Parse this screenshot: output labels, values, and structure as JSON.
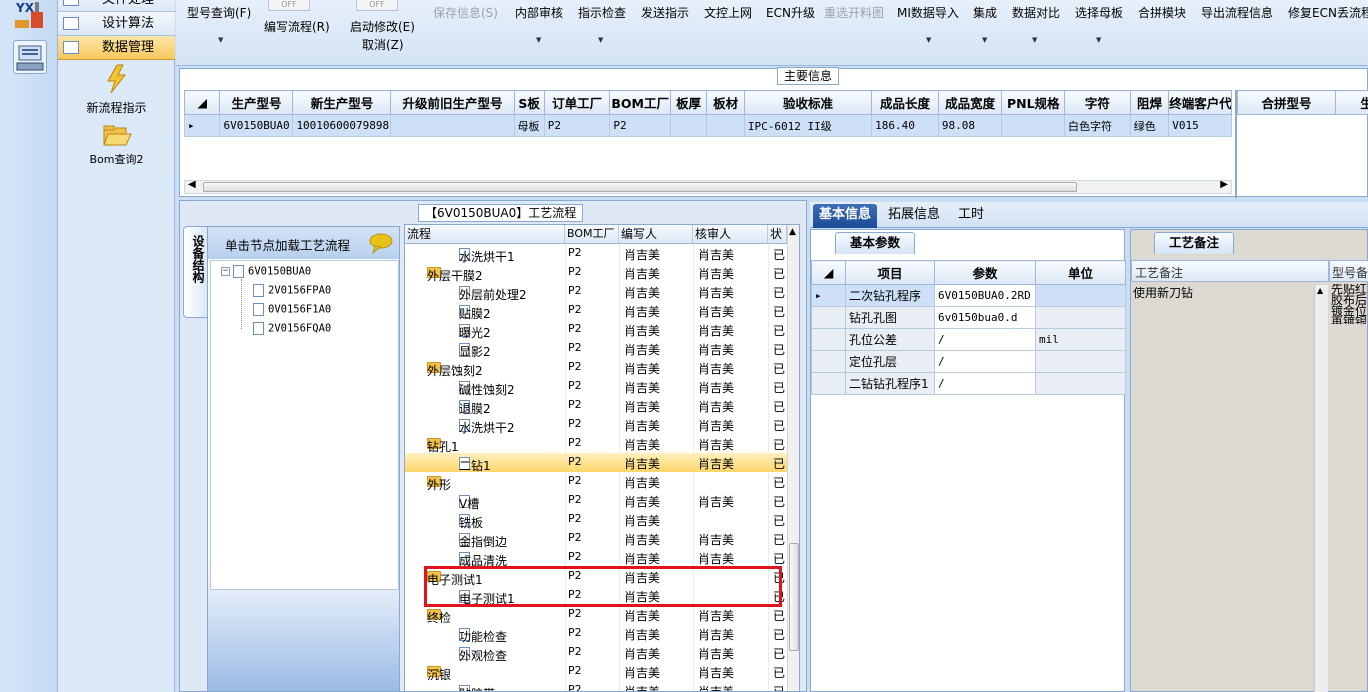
{
  "app": {
    "logo_text": "YX"
  },
  "nav": {
    "items": [
      {
        "label": "文件处理"
      },
      {
        "label": "设计算法"
      },
      {
        "label": "数据管理"
      }
    ],
    "buttons": [
      {
        "label": "新流程指示"
      },
      {
        "label": "Bom查询2"
      }
    ]
  },
  "toolbar": {
    "off_label": "OFF",
    "items": [
      {
        "label": "型号查询(F)"
      },
      {
        "label": "编写流程(R)"
      },
      {
        "label": "启动修改(E)"
      },
      {
        "label": "取消(Z)"
      },
      {
        "label": "保存信息(S)"
      },
      {
        "label": "内部审核"
      },
      {
        "label": "指示检查"
      },
      {
        "label": "发送指示"
      },
      {
        "label": "文控上网"
      },
      {
        "label": "ECN升级"
      },
      {
        "label": "重选开料图"
      },
      {
        "label": "MI数据导入"
      },
      {
        "label": "集成"
      },
      {
        "label": "数据对比"
      },
      {
        "label": "选择母板"
      },
      {
        "label": "合拼模块"
      },
      {
        "label": "导出流程信息"
      },
      {
        "label": "修复ECN丢流程"
      }
    ]
  },
  "main_info": {
    "title": "主要信息",
    "columns": [
      "生产型号",
      "新生产型号",
      "升级前旧生产型号",
      "S板",
      "订单工厂",
      "BOM工厂",
      "板厚",
      "板材",
      "验收标准",
      "成品长度",
      "成品宽度",
      "PNL规格",
      "字符",
      "阻焊",
      "终端客户代码"
    ],
    "row": [
      "6V0150BUA0",
      "10010600079898",
      "",
      "母板",
      "P2",
      "P2",
      "",
      "",
      "IPC-6012 II级",
      "186.40",
      "98.08",
      "",
      "白色字符",
      "绿色",
      "V015"
    ],
    "side_columns": [
      "合拼型号",
      "生"
    ]
  },
  "process": {
    "title": "【6V0150BUA0】工艺流程",
    "side_tab": "设备结构",
    "tree_header": "单击节点加载工艺流程",
    "tree": [
      {
        "label": "6V0150BUA0",
        "level": 0
      },
      {
        "label": "2V0156FPA0",
        "level": 1
      },
      {
        "label": "0V0156F1A0",
        "level": 1
      },
      {
        "label": "2V0156FQA0",
        "level": 1
      }
    ],
    "grid_columns": [
      "流程",
      "BOM工厂",
      "编写人",
      "核审人",
      "状"
    ],
    "rows": [
      {
        "name": "水洗烘干1",
        "folder": false,
        "factory": "P2",
        "writer": "肖吉美",
        "reviewer": "肖吉美",
        "status": "已"
      },
      {
        "name": "外层干膜2",
        "folder": true,
        "factory": "P2",
        "writer": "肖吉美",
        "reviewer": "肖吉美",
        "status": "已"
      },
      {
        "name": "外层前处理2",
        "folder": false,
        "factory": "P2",
        "writer": "肖吉美",
        "reviewer": "肖吉美",
        "status": "已"
      },
      {
        "name": "贴膜2",
        "folder": false,
        "factory": "P2",
        "writer": "肖吉美",
        "reviewer": "肖吉美",
        "status": "已"
      },
      {
        "name": "曝光2",
        "folder": false,
        "factory": "P2",
        "writer": "肖吉美",
        "reviewer": "肖吉美",
        "status": "已"
      },
      {
        "name": "显影2",
        "folder": false,
        "factory": "P2",
        "writer": "肖吉美",
        "reviewer": "肖吉美",
        "status": "已"
      },
      {
        "name": "外层蚀刻2",
        "folder": true,
        "factory": "P2",
        "writer": "肖吉美",
        "reviewer": "肖吉美",
        "status": "已"
      },
      {
        "name": "碱性蚀刻2",
        "folder": false,
        "factory": "P2",
        "writer": "肖吉美",
        "reviewer": "肖吉美",
        "status": "已"
      },
      {
        "name": "退膜2",
        "folder": false,
        "factory": "P2",
        "writer": "肖吉美",
        "reviewer": "肖吉美",
        "status": "已"
      },
      {
        "name": "水洗烘干2",
        "folder": false,
        "factory": "P2",
        "writer": "肖吉美",
        "reviewer": "肖吉美",
        "status": "已"
      },
      {
        "name": "钻孔1",
        "folder": true,
        "factory": "P2",
        "writer": "肖吉美",
        "reviewer": "肖吉美",
        "status": "已"
      },
      {
        "name": "二钻1",
        "folder": false,
        "factory": "P2",
        "writer": "肖吉美",
        "reviewer": "肖吉美",
        "status": "已",
        "selected": true
      },
      {
        "name": "外形",
        "folder": true,
        "factory": "P2",
        "writer": "肖吉美",
        "reviewer": "",
        "status": "已"
      },
      {
        "name": "V槽",
        "folder": false,
        "factory": "P2",
        "writer": "肖吉美",
        "reviewer": "肖吉美",
        "status": "已"
      },
      {
        "name": "铣板",
        "folder": false,
        "factory": "P2",
        "writer": "肖吉美",
        "reviewer": "",
        "status": "已"
      },
      {
        "name": "金指倒边",
        "folder": false,
        "factory": "P2",
        "writer": "肖吉美",
        "reviewer": "肖吉美",
        "status": "已"
      },
      {
        "name": "成品清洗",
        "folder": false,
        "factory": "P2",
        "writer": "肖吉美",
        "reviewer": "肖吉美",
        "status": "已"
      },
      {
        "name": "电子测试1",
        "folder": true,
        "factory": "P2",
        "writer": "肖吉美",
        "reviewer": "",
        "status": "已"
      },
      {
        "name": "电子测试1",
        "folder": false,
        "factory": "P2",
        "writer": "肖吉美",
        "reviewer": "",
        "status": "已"
      },
      {
        "name": "终检",
        "folder": true,
        "factory": "P2",
        "writer": "肖吉美",
        "reviewer": "肖吉美",
        "status": "已"
      },
      {
        "name": "功能检查",
        "folder": false,
        "factory": "P2",
        "writer": "肖吉美",
        "reviewer": "肖吉美",
        "status": "已"
      },
      {
        "name": "外观检查",
        "folder": false,
        "factory": "P2",
        "writer": "肖吉美",
        "reviewer": "肖吉美",
        "status": "已"
      },
      {
        "name": "沉银",
        "folder": true,
        "factory": "P2",
        "writer": "肖吉美",
        "reviewer": "肖吉美",
        "status": "已"
      },
      {
        "name": "贴胶带",
        "folder": false,
        "factory": "P2",
        "writer": "肖吉美",
        "reviewer": "肖吉美",
        "status": "已"
      }
    ]
  },
  "detail": {
    "tabs": [
      "基本信息",
      "拓展信息",
      "工时"
    ],
    "basic_tab": "基本参数",
    "columns": [
      "项目",
      "参数",
      "单位"
    ],
    "rows": [
      {
        "item": "二次钻孔程序",
        "param": "6V0150BUA0.2RD",
        "unit": ""
      },
      {
        "item": "钻孔孔图",
        "param": "6v0150bua0.d",
        "unit": ""
      },
      {
        "item": "孔位公差",
        "param": "/",
        "unit": "mil"
      },
      {
        "item": "定位孔层",
        "param": "/",
        "unit": ""
      },
      {
        "item": "二钻钻孔程序1",
        "param": "/",
        "unit": ""
      }
    ],
    "note_tab": "工艺备注",
    "note_columns": [
      "工艺备注",
      "型号备"
    ],
    "note_text": "使用新刀钻",
    "note_side_text": "先贴红胶布后镀金位再镀银"
  }
}
